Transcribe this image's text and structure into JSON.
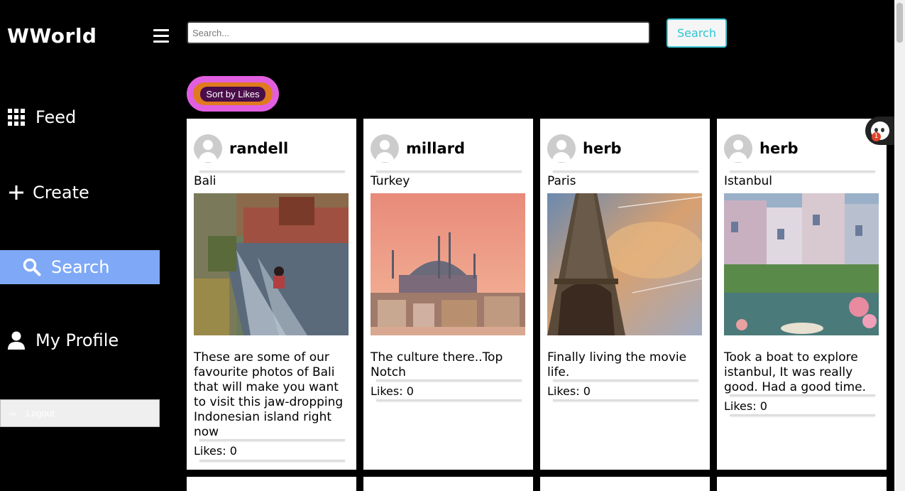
{
  "app": {
    "brand": "WWorld"
  },
  "sidebar": {
    "items": [
      {
        "label": "Feed",
        "icon": "grid-icon",
        "active": false
      },
      {
        "label": "Create",
        "icon": "plus-icon",
        "active": false
      },
      {
        "label": "Search",
        "icon": "search-icon",
        "active": true
      },
      {
        "label": "My Profile",
        "icon": "user-icon",
        "active": false
      }
    ],
    "logout_label": "Logout",
    "active_color": "#7fa9f7"
  },
  "search": {
    "placeholder": "Search...",
    "value": "",
    "button_label": "Search"
  },
  "sort": {
    "label": "Sort by Likes"
  },
  "posts": [
    {
      "username": "randell",
      "location": "Bali",
      "caption": "These are some of our favourite photos of Bali that will make you want to visit this jaw-dropping Indonesian island right now",
      "likes": "Likes: 0"
    },
    {
      "username": "millard",
      "location": "Turkey",
      "caption": "The culture there..Top Notch",
      "likes": "Likes: 0"
    },
    {
      "username": "herb",
      "location": "Paris",
      "caption": "Finally living the movie life.",
      "likes": "Likes: 0"
    },
    {
      "username": "herb",
      "location": "Istanbul",
      "caption": "Took a boat to explore istanbul, It was really good. Had a good time.",
      "likes": "Likes: 0"
    }
  ],
  "bot": {
    "badge": "1"
  }
}
